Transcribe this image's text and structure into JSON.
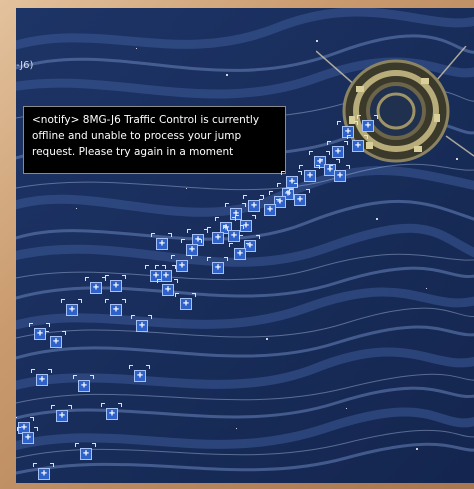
{
  "window": {
    "system_label": "-J6)"
  },
  "notification": {
    "lines": [
      "<notify> 8MG-J6 Traffic Control is currently",
      "offline and unable to process your jump",
      "request. Please try again in a moment"
    ]
  },
  "colors": {
    "space": "#1b2f5e",
    "bracket": "#2f62c9",
    "frame": "#c99a6d"
  },
  "icons": {
    "bracket": "ship-bracket-icon",
    "station": "space-station-icon"
  }
}
